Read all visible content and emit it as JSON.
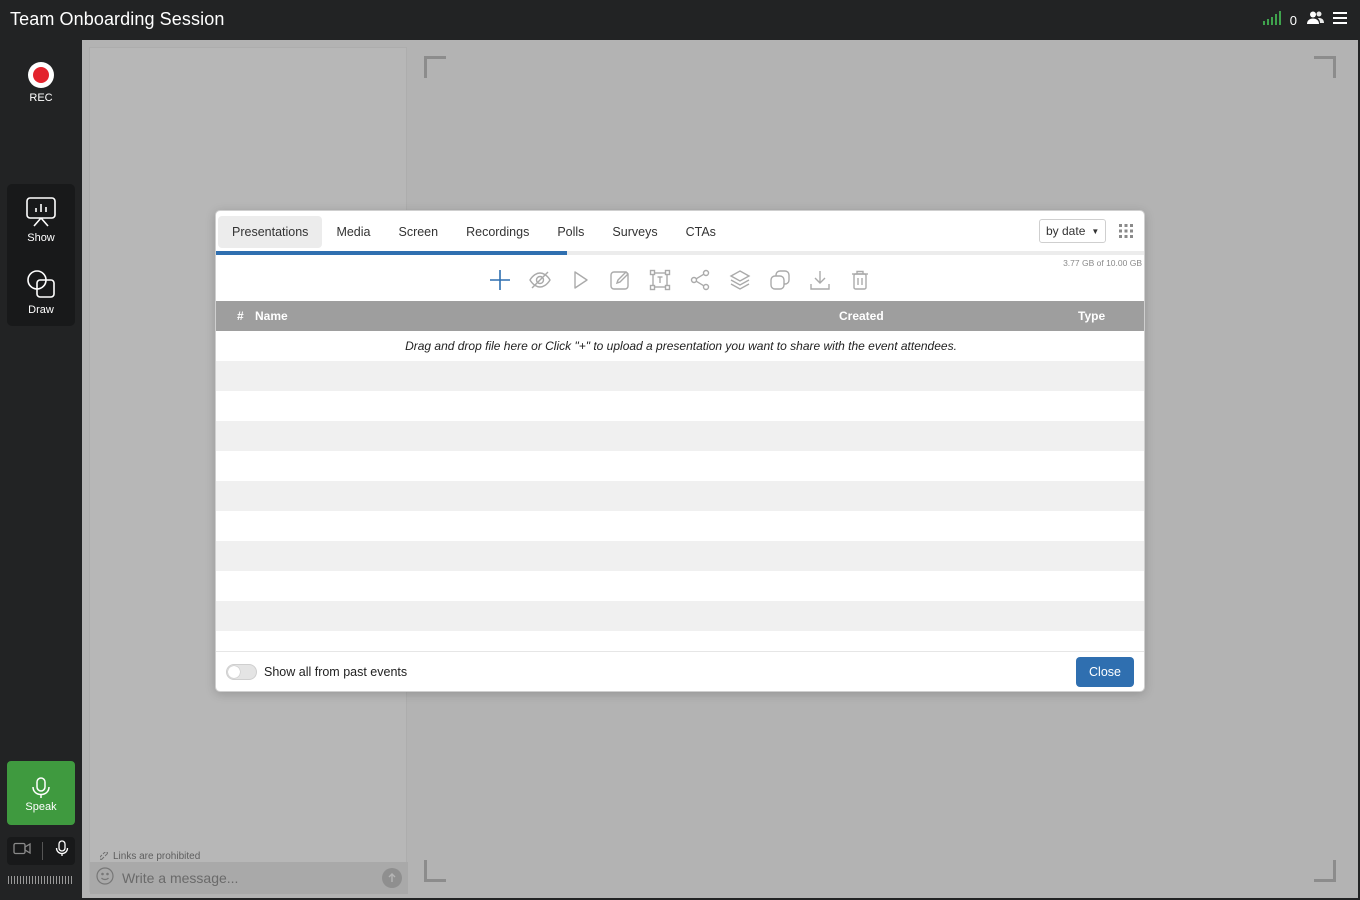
{
  "app": {
    "title": "Team Onboarding Session"
  },
  "topbar": {
    "signal_icon": "signal-bars-icon",
    "participant_count": "0",
    "participants_icon": "people-icon",
    "menu_icon": "hamburger-icon",
    "signal_color": "#3fa34d"
  },
  "rail": {
    "rec_label": "REC",
    "show_label": "Show",
    "draw_label": "Draw",
    "speak_label": "Speak",
    "speak_color": "#3f9a3f",
    "rec_color": "#e3232d"
  },
  "chat": {
    "links_note": "Links are prohibited",
    "placeholder": "Write a message..."
  },
  "modal": {
    "tabs": [
      {
        "label": "Presentations",
        "active": true
      },
      {
        "label": "Media"
      },
      {
        "label": "Screen"
      },
      {
        "label": "Recordings"
      },
      {
        "label": "Polls"
      },
      {
        "label": "Surveys"
      },
      {
        "label": "CTAs"
      }
    ],
    "sort_value": "by date",
    "storage": "3.77 GB of 10.00 GB",
    "storage_used_fraction": 0.377,
    "accent_color": "#2f6fb0",
    "toolbar_icons": [
      "plus-icon",
      "eye-off-icon",
      "play-icon",
      "edit-icon",
      "resize-icon",
      "share-icon",
      "layers-icon",
      "copy-icon",
      "download-icon",
      "trash-icon"
    ],
    "columns": {
      "num": "#",
      "name": "Name",
      "created": "Created",
      "type": "Type"
    },
    "empty_message": "Drag and drop file here or Click \"+\" to upload a presentation you want to share with the event attendees.",
    "toggle_label": "Show all from past events",
    "toggle_on": false,
    "close_label": "Close"
  }
}
